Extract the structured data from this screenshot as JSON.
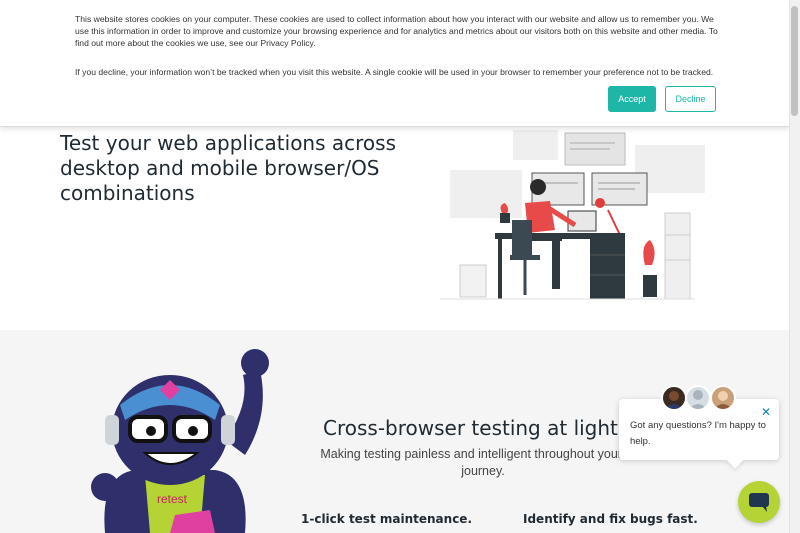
{
  "cookie_banner": {
    "paragraph1": "This website stores cookies on your computer. These cookies are used to collect information about how you interact with our website and allow us to remember you. We use this information in order to improve and customize your browsing experience and for analytics and metrics about our visitors both on this website and other media. To find out more about the cookies we use, see our Privacy Policy.",
    "paragraph2": "If you decline, your information won’t be tracked when you visit this website. A single cookie will be used in your browser to remember your preference not to be tracked.",
    "accept_label": "Accept",
    "decline_label": "Decline"
  },
  "hero": {
    "title": "Test your web applications across desktop and mobile browser/OS combinations"
  },
  "section2": {
    "title": "Cross-browser testing at lightning",
    "subtitle": "Making testing painless and intelligent throughout your test journey.",
    "feature1": "1-click test maintenance.",
    "feature2": "Identify and fix bugs fast.",
    "mascot_shirt_text": "retest"
  },
  "chat": {
    "message": "Got any questions? I'm happy to help.",
    "close_icon": "close-icon",
    "launcher_icon": "chat-icon"
  },
  "colors": {
    "accent": "#1eb6a6",
    "chat_launcher": "#b5d334",
    "section_bg": "#f5f5f5"
  }
}
